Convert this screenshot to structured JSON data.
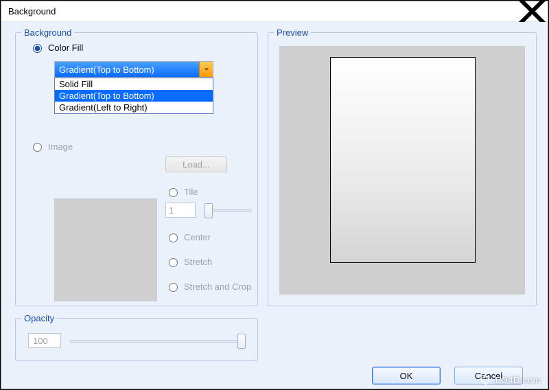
{
  "window": {
    "title": "Background"
  },
  "background": {
    "legend": "Background",
    "color_fill_label": "Color Fill",
    "combo_selected": "Gradient(Top to Bottom)",
    "combo_options": [
      "Solid Fill",
      "Gradient(Top to Bottom)",
      "Gradient(Left to Right)"
    ],
    "image_label": "Image",
    "load_label": "Load...",
    "tile_label": "Tile",
    "tile_value": "1",
    "center_label": "Center",
    "stretch_label": "Stretch",
    "stretch_crop_label": "Stretch and Crop"
  },
  "preview": {
    "legend": "Preview"
  },
  "opacity": {
    "legend": "Opacity",
    "value": "100"
  },
  "buttons": {
    "ok": "OK",
    "cancel": "Cancel"
  },
  "watermark": "LO4D.com"
}
